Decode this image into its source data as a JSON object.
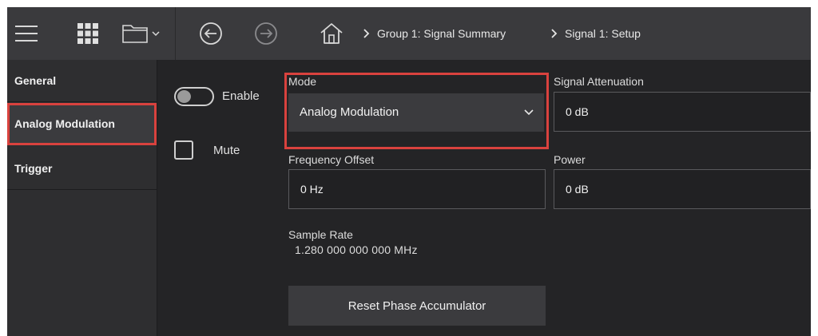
{
  "toolbar": {
    "icons": [
      "menu-icon",
      "app-grid-icon",
      "folder-icon",
      "chevron-down-icon",
      "back-icon",
      "forward-icon",
      "home-icon"
    ]
  },
  "breadcrumb": {
    "items": [
      "Group 1: Signal Summary",
      "Signal 1: Setup"
    ]
  },
  "sidebar": {
    "items": [
      {
        "label": "General"
      },
      {
        "label": "Analog Modulation"
      },
      {
        "label": "Trigger"
      }
    ]
  },
  "controls": {
    "enable_label": "Enable",
    "enable_state": "off",
    "mute_label": "Mute",
    "mute_checked": false
  },
  "mode": {
    "label": "Mode",
    "value": "Analog Modulation"
  },
  "signal_attenuation": {
    "label": "Signal Attenuation",
    "value": "0 dB"
  },
  "frequency_offset": {
    "label": "Frequency Offset",
    "value": "0 Hz"
  },
  "power": {
    "label": "Power",
    "value": "0 dB"
  },
  "sample_rate": {
    "label": "Sample Rate",
    "value": "1.280 000 000 000 MHz"
  },
  "reset_button": {
    "label": "Reset Phase Accumulator"
  },
  "colors": {
    "background": "#242426",
    "topbar": "#3a3a3d",
    "highlight": "#d9423e"
  }
}
